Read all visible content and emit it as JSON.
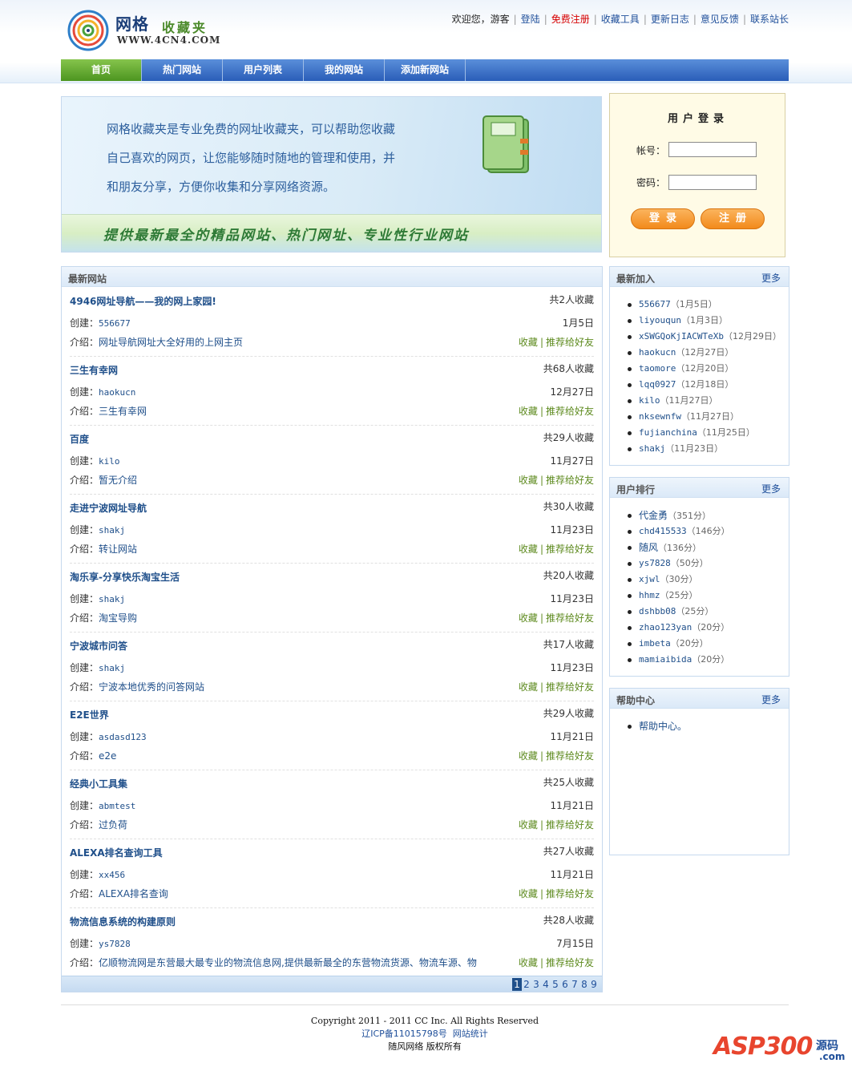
{
  "header": {
    "logo": {
      "title": "网格",
      "subtitle": "收藏夹",
      "domain": "WWW.4CN4.COM"
    },
    "top_links": {
      "welcome": "欢迎您，游客",
      "login": "登陆",
      "register": "免费注册",
      "tools": "收藏工具",
      "changelog": "更新日志",
      "feedback": "意见反馈",
      "contact": "联系站长"
    },
    "colors": {
      "nav_blue": "#2a5db8",
      "nav_active": "#4c9520",
      "link": "#1f4f8a",
      "register_red": "#d60000"
    }
  },
  "nav": {
    "items": [
      "首页",
      "热门网站",
      "用户列表",
      "我的网站",
      "添加新网站"
    ]
  },
  "banner": {
    "intro_lines": [
      "网格收藏夹是专业免费的网址收藏夹，可以帮助您收藏",
      "自己喜欢的网页，让您能够随时随地的管理和使用，并",
      "和朋友分享，方便你收集和分享网络资源。"
    ],
    "slogan": "提供最新最全的精品网站、热门网址、专业性行业网站"
  },
  "login": {
    "title": "用户登录",
    "account_label": "帐号：",
    "password_label": "密码：",
    "account_value": "",
    "password_value": "",
    "login_button": "登录",
    "register_button": "注册"
  },
  "newest": {
    "title": "最新网站",
    "creator_prefix": "创建：",
    "desc_prefix": "介绍：",
    "action_collect": "收藏",
    "action_recommend": "推荐给好友",
    "sites": [
      {
        "name": "4946网址导航——我的网上家园!",
        "count": "共2人收藏",
        "creator": "556677",
        "date": "1月5日",
        "desc": "网址导航网址大全好用的上网主页"
      },
      {
        "name": "三生有幸网",
        "count": "共68人收藏",
        "creator": "haokucn",
        "date": "12月27日",
        "desc": "三生有幸网"
      },
      {
        "name": "百度",
        "count": "共29人收藏",
        "creator": "kilo",
        "date": "11月27日",
        "desc": "暂无介绍"
      },
      {
        "name": "走进宁波网址导航",
        "count": "共30人收藏",
        "creator": "shakj",
        "date": "11月23日",
        "desc": "转让网站"
      },
      {
        "name": "淘乐享-分享快乐淘宝生活",
        "count": "共20人收藏",
        "creator": "shakj",
        "date": "11月23日",
        "desc": "淘宝导购"
      },
      {
        "name": "宁波城市问答",
        "count": "共17人收藏",
        "creator": "shakj",
        "date": "11月23日",
        "desc": "宁波本地优秀的问答网站"
      },
      {
        "name": "E2E世界",
        "count": "共29人收藏",
        "creator": "asdasd123",
        "date": "11月21日",
        "desc": "e2e"
      },
      {
        "name": "经典小工具集",
        "count": "共25人收藏",
        "creator": "abmtest",
        "date": "11月21日",
        "desc": "过负荷"
      },
      {
        "name": "ALEXA排名查询工具",
        "count": "共27人收藏",
        "creator": "xx456",
        "date": "11月21日",
        "desc": "ALEXA排名查询"
      },
      {
        "name": "物流信息系统的构建原则",
        "count": "共28人收藏",
        "creator": "ys7828",
        "date": "7月15日",
        "desc": "亿顺物流网是东营最大最专业的物流信息网,提供最新最全的东营物流货源、物流车源、物"
      }
    ],
    "pages": [
      "1",
      "2",
      "3",
      "4",
      "5",
      "6",
      "7",
      "8",
      "9"
    ],
    "current_page": "1"
  },
  "recent_joined": {
    "title": "最新加入",
    "more": "更多",
    "items": [
      {
        "user": "556677",
        "date": "（1月5日）"
      },
      {
        "user": "liyouqun",
        "date": "（1月3日）"
      },
      {
        "user": "xSWGQoKjIACWTeXb",
        "date": "（12月29日）"
      },
      {
        "user": "haokucn",
        "date": "（12月27日）"
      },
      {
        "user": "taomore",
        "date": "（12月20日）"
      },
      {
        "user": "lqq0927",
        "date": "（12月18日）"
      },
      {
        "user": "kilo",
        "date": "（11月27日）"
      },
      {
        "user": "nksewnfw",
        "date": "（11月27日）"
      },
      {
        "user": "fujianchina",
        "date": "（11月25日）"
      },
      {
        "user": "shakj",
        "date": "（11月23日）"
      }
    ]
  },
  "user_rank": {
    "title": "用户排行",
    "more": "更多",
    "items": [
      {
        "user": "代金勇",
        "score": "（351分）"
      },
      {
        "user": "chd415533",
        "score": "（146分）"
      },
      {
        "user": "随风",
        "score": "（136分）"
      },
      {
        "user": "ys7828",
        "score": "（50分）"
      },
      {
        "user": "xjwl",
        "score": "（30分）"
      },
      {
        "user": "hhmz",
        "score": "（25分）"
      },
      {
        "user": "dshbb08",
        "score": "（25分）"
      },
      {
        "user": "zhao123yan",
        "score": "（20分）"
      },
      {
        "user": "imbeta",
        "score": "（20分）"
      },
      {
        "user": "mamiaibida",
        "score": "（20分）"
      }
    ]
  },
  "help": {
    "title": "帮助中心",
    "more": "更多",
    "items": [
      "帮助中心。"
    ]
  },
  "footer": {
    "copyright": "Copyright 2011 - 2011 CC Inc. All Rights Reserved",
    "icp": "辽ICP备11015798号",
    "stats": "网站统计",
    "owner": "随风网络 版权所有"
  },
  "watermark": {
    "brand": "ASP300",
    "cn": "源码",
    "domain": ".com"
  }
}
